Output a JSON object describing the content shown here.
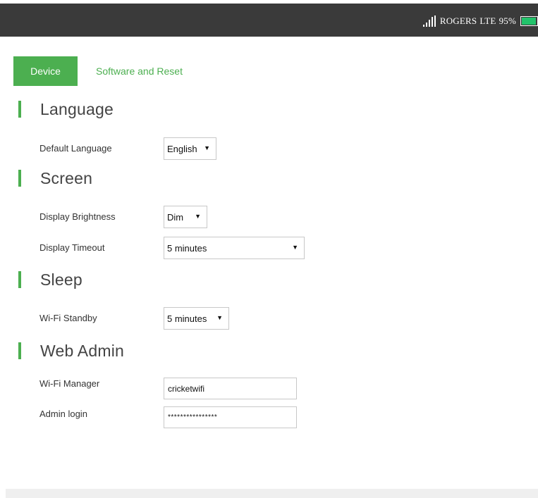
{
  "status_bar": {
    "carrier": "ROGERS",
    "network": "LTE",
    "battery_percent": "95%",
    "battery_level": 0.95,
    "signal_icon": "signal-bars-icon",
    "battery_icon": "battery-icon",
    "battery_color": "#22c36b"
  },
  "tabs": [
    {
      "label": "Device",
      "active": true
    },
    {
      "label": "Software and Reset",
      "active": false
    }
  ],
  "sections": {
    "language": {
      "title": "Language",
      "default_language": {
        "label": "Default Language",
        "value": "English"
      }
    },
    "screen": {
      "title": "Screen",
      "brightness": {
        "label": "Display Brightness",
        "value": "Dim"
      },
      "timeout": {
        "label": "Display Timeout",
        "value": "5 minutes"
      }
    },
    "sleep": {
      "title": "Sleep",
      "standby": {
        "label": "Wi-Fi Standby",
        "value": "5 minutes"
      }
    },
    "web_admin": {
      "title": "Web Admin",
      "wifi_manager": {
        "label": "Wi-Fi Manager",
        "value": "cricketwifi"
      },
      "admin_login": {
        "label": "Admin login",
        "value": "****************"
      }
    }
  },
  "colors": {
    "accent": "#4caf50",
    "topbar": "#3a3a3a"
  }
}
